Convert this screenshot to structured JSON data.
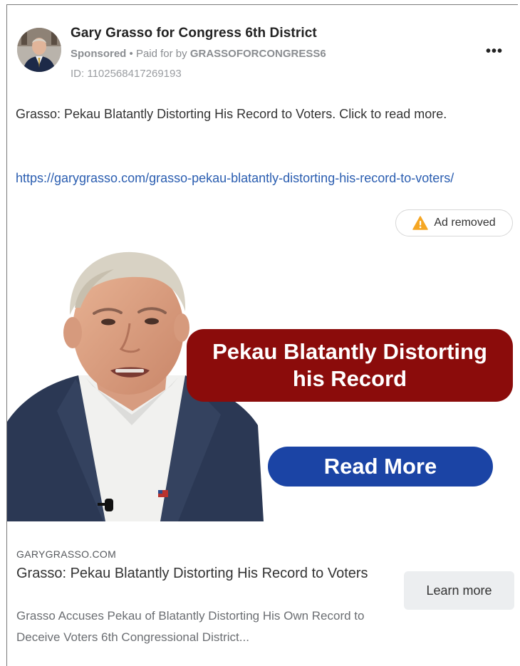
{
  "post": {
    "page_name": "Gary Grasso for Congress 6th District",
    "sponsored_label": "Sponsored",
    "separator": " • ",
    "paid_for_prefix": "Paid for by ",
    "payer": "GRASSOFORCONGRESS6",
    "ad_id": "ID: 1102568417269193",
    "more_label": "•••",
    "body_text": "Grasso: Pekau Blatantly Distorting His Record to Voters. Click to read more.",
    "body_link": "https://garygrasso.com/grasso-pekau-blatantly-distorting-his-record-to-voters/",
    "status_badge": "Ad removed"
  },
  "creative": {
    "headline": "Pekau Blatantly Distorting his Record",
    "cta": "Read More"
  },
  "link_preview": {
    "domain": "GARYGRASSO.COM",
    "title": "Grasso: Pekau Blatantly Distorting His Record to Voters",
    "description": "Grasso Accuses Pekau of Blatantly Distorting His Own Record to Deceive Voters 6th Congressional District...",
    "button_label": "Learn more"
  },
  "colors": {
    "headline_bg": "#8b0c0b",
    "cta_bg": "#1b44a5",
    "link": "#2a5db0",
    "warning": "#f5a623"
  },
  "icons": {
    "status": "warning-icon",
    "menu": "more-options-icon"
  }
}
